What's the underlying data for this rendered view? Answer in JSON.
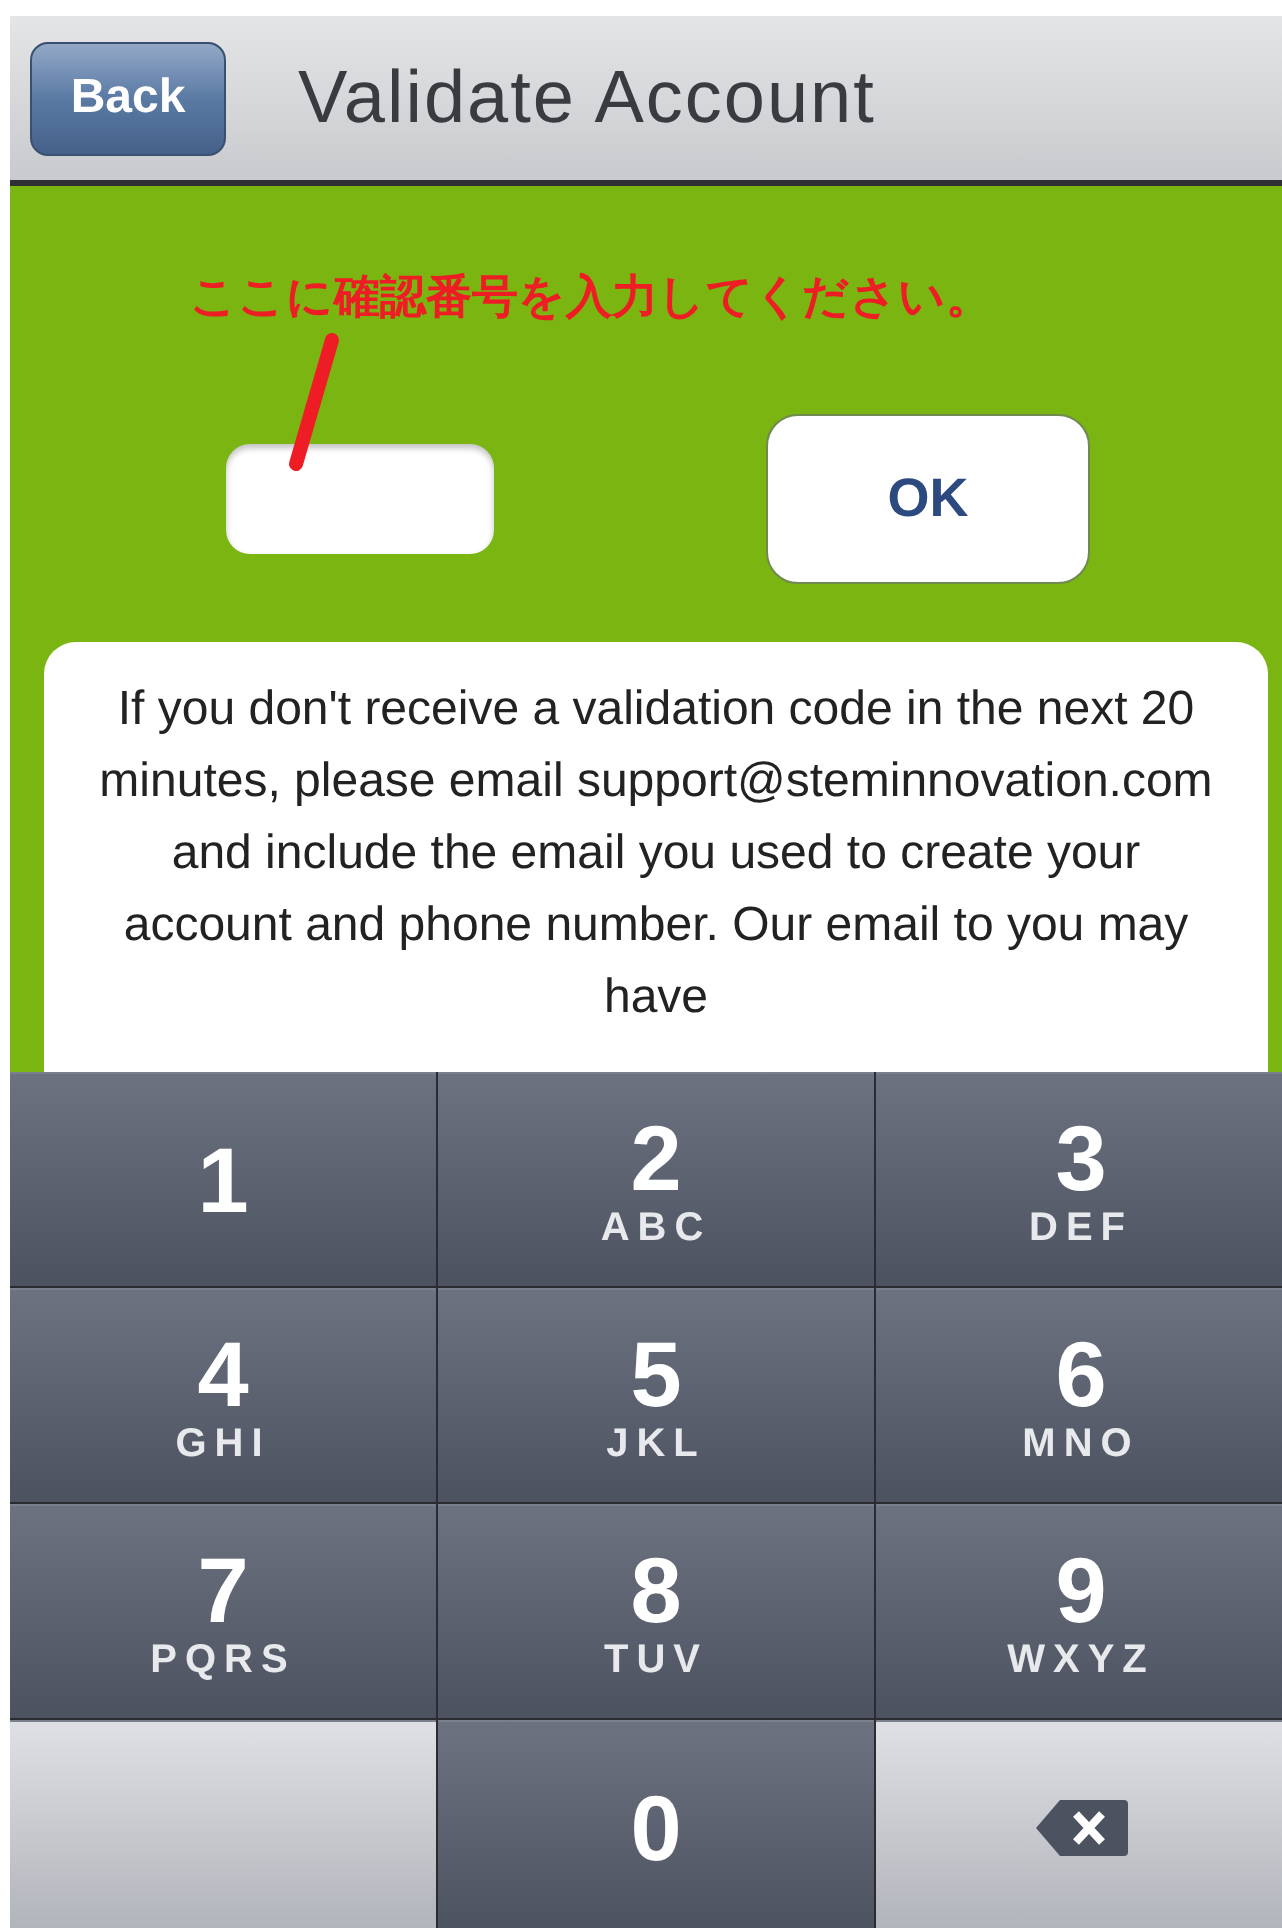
{
  "header": {
    "back": "Back",
    "title": "Validate Account"
  },
  "annotation": "ここに確認番号を入力してください。",
  "ok_button": "OK",
  "notice": "If you don't receive a validation code in the next 20 minutes, please email support@steminnovation.com and include the email you used to create your account and phone number. Our email to you may have",
  "keypad": [
    {
      "kind": "digit",
      "digit": "1"
    },
    {
      "kind": "digit",
      "digit": "2",
      "letters": "ABC"
    },
    {
      "kind": "digit",
      "digit": "3",
      "letters": "DEF"
    },
    {
      "kind": "digit",
      "digit": "4",
      "letters": "GHI"
    },
    {
      "kind": "digit",
      "digit": "5",
      "letters": "JKL"
    },
    {
      "kind": "digit",
      "digit": "6",
      "letters": "MNO"
    },
    {
      "kind": "digit",
      "digit": "7",
      "letters": "PQRS"
    },
    {
      "kind": "digit",
      "digit": "8",
      "letters": "TUV"
    },
    {
      "kind": "digit",
      "digit": "9",
      "letters": "WXYZ"
    },
    {
      "kind": "blank"
    },
    {
      "kind": "digit",
      "digit": "0"
    },
    {
      "kind": "delete"
    }
  ]
}
